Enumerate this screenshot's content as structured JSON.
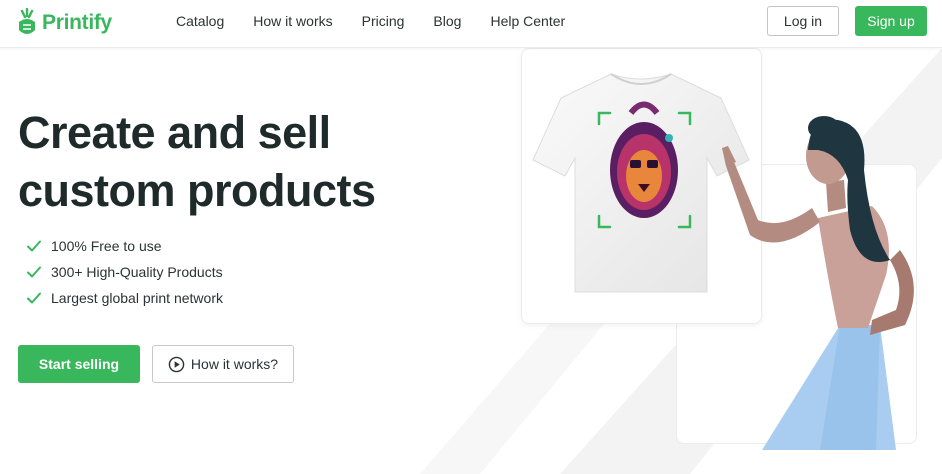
{
  "brand": {
    "name": "Printify",
    "color": "#39b75d"
  },
  "nav": {
    "items": [
      {
        "label": "Catalog"
      },
      {
        "label": "How it works"
      },
      {
        "label": "Pricing"
      },
      {
        "label": "Blog"
      },
      {
        "label": "Help Center"
      }
    ],
    "login_label": "Log in",
    "signup_label": "Sign up"
  },
  "hero": {
    "title_line1": "Create and sell",
    "title_line2": "custom products",
    "features": [
      {
        "label": "100% Free to use",
        "icon": "check-icon"
      },
      {
        "label": "300+ High-Quality Products",
        "icon": "check-icon"
      },
      {
        "label": "Largest global print network",
        "icon": "check-icon"
      }
    ],
    "start_label": "Start selling",
    "how_label": "How it works?",
    "how_icon": "play-circle-icon"
  },
  "illustration": {
    "tshirt": "tshirt-with-lion-print",
    "woman": "woman-pointing-illustration"
  }
}
